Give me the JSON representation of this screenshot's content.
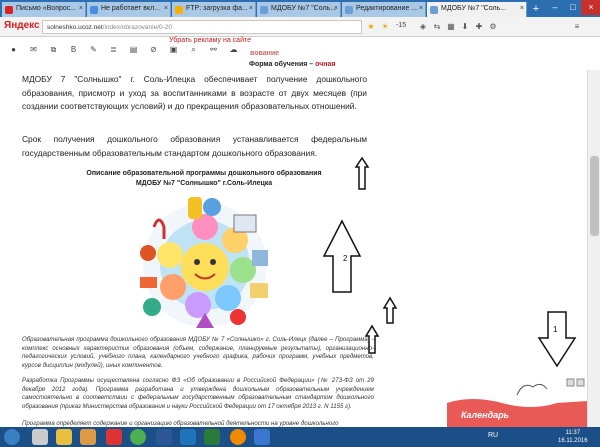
{
  "browser": {
    "tabs": [
      {
        "label": "Письмо «Вопрос...",
        "icon": "mail-icon",
        "color": "#d22"
      },
      {
        "label": "Не работает вкл...",
        "icon": "page-icon",
        "color": "#4a8de0"
      },
      {
        "label": "FTP: загрузка фа...",
        "icon": "ftp-icon",
        "color": "#f6b100"
      },
      {
        "label": "МДОБУ №7 \"Соль...",
        "icon": "site-icon",
        "color": "#6a9fd6"
      },
      {
        "label": "Редактирование ...",
        "icon": "site-icon",
        "color": "#6a9fd6"
      },
      {
        "label": "МДОБУ №7 \"Соль...",
        "icon": "site-icon",
        "color": "#6a9fd6",
        "active": true
      }
    ],
    "logo": "Яндекс",
    "url_host": "solneshko.ucoz.net",
    "url_path": "/index/obrazovanie/0-20",
    "score": "-15"
  },
  "page": {
    "ad_link": "Убрать рекламу на сайте",
    "orange_fragment": "вование",
    "forma_label": "Форма обучения – ",
    "forma_value": "очная",
    "para1": "МДОБУ 7 \"Солнышко\" г. Соль-Илецка обеспечивает получение дошкольного образования, присмотр и уход за воспитанниками в возрасте от двух месяцев (при создании соответствующих условий) и до прекращения образовательных отношений.",
    "para2": "Срок получения дошкольного образования устанавливается федеральным государственным образовательным стандартом дошкольного образования.",
    "desc_title": "Описание образовательной программы дошкольного образования МДОБУ №7 \"Солнышко\" г.Соль-Илецка",
    "small1": "Образовательная программа дошкольного образования МДОБУ № 7 «Солнышко» г. Соль-Илецк (далее – Программа) - комплекс основных характеристик образования (объем, содержание, планируемые результаты), организационно-педагогических условий, учебного плана, календарного учебного графика, рабочих программ, учебных предметов, курсов дисциплин (модулей), иных компонентов.",
    "small2": "Разработка Программы осуществлена согласно ФЗ «Об образовании в Российской Федерации» (№ 273-ФЗ от 29 декабря 2012 года). Программа разработана и утверждена дошкольным образовательным учреждением самостоятельно в соответствии с федеральным государственным образовательным стандартом дошкольного образования (приказ Министерства образования и науки Российской Федерации от 17 октября 2013 г. N 1155 г).",
    "small3": "Программа определяет содержание и организацию образовательной деятельности на уровне дошкольного",
    "calendar_label": "Календарь",
    "arrow_labels": {
      "big": "2",
      "down": "1"
    }
  },
  "taskbar": {
    "lang": "RU",
    "time": "11:37",
    "date": "16.11.2016"
  }
}
